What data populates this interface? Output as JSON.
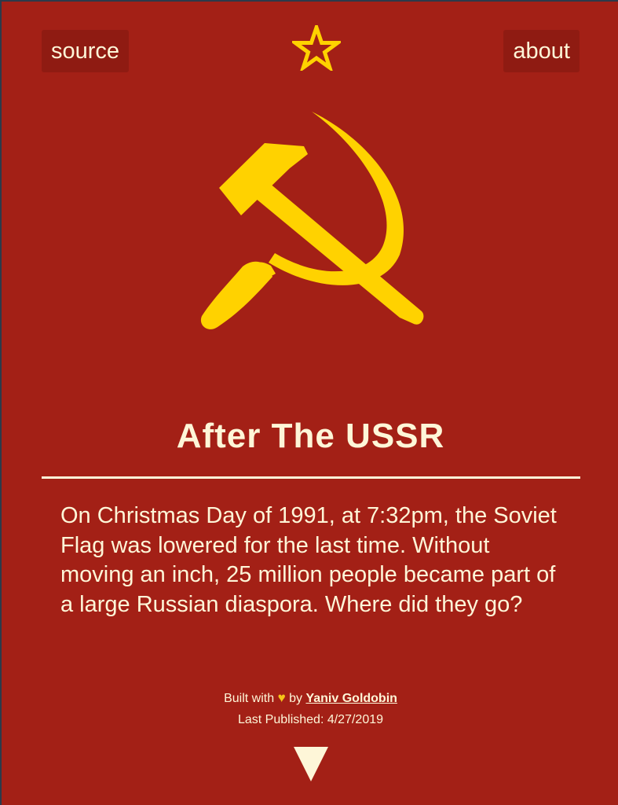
{
  "nav": {
    "source_label": "source",
    "about_label": "about"
  },
  "icons": {
    "star": "star-icon",
    "emblem": "hammer-and-sickle-icon",
    "heart": "heart-icon",
    "arrow": "down-arrow-icon"
  },
  "header": {
    "title": "After The USSR"
  },
  "intro": {
    "text": "On Christmas Day of 1991, at 7:32pm, the Soviet Flag was lowered for the last time. Without moving an inch, 25 million people became part of a large Russian diaspora. Where did they go?"
  },
  "footer": {
    "built_with": "Built with",
    "by": "by",
    "author": "Yaniv Goldobin",
    "published": "Last Published: 4/27/2019"
  },
  "colors": {
    "background": "#a32016",
    "accent": "#ffd200",
    "text": "#fef6d8",
    "button_bg": "#8f1b12",
    "heart": "#f5c518"
  }
}
